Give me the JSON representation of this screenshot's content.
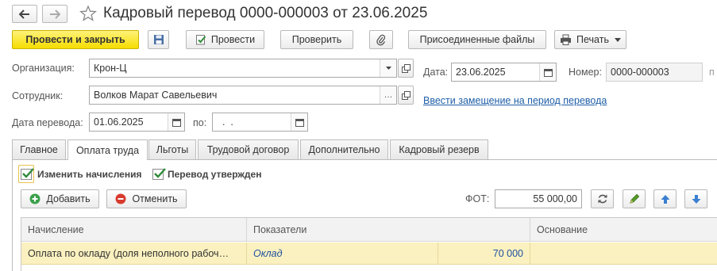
{
  "window": {
    "title": "Кадровый перевод 0000-000003 от 23.06.2025"
  },
  "toolbar": {
    "post_close_label": "Провести и закрыть",
    "post_label": "Провести",
    "check_label": "Проверить",
    "files_label": "Присоединенные файлы",
    "print_label": "Печать"
  },
  "form": {
    "organization_label": "Организация:",
    "organization_value": "Крон-Ц",
    "date_label": "Дата:",
    "date_value": "23.06.2025",
    "number_label": "Номер:",
    "number_value": "0000-000003",
    "number_suffix": "п",
    "employee_label": "Сотрудник:",
    "employee_value": "Волков Марат Савельевич",
    "replacement_link": "Ввести замещение на период перевода",
    "transfer_date_label": "Дата перевода:",
    "transfer_date_value": "01.06.2025",
    "to_label": "по:",
    "to_value": "  .  ."
  },
  "tabs": [
    {
      "label": "Главное"
    },
    {
      "label": "Оплата труда"
    },
    {
      "label": "Льготы"
    },
    {
      "label": "Трудовой договор"
    },
    {
      "label": "Дополнительно"
    },
    {
      "label": "Кадровый резерв"
    }
  ],
  "active_tab": "Оплата труда",
  "payroll": {
    "change_accruals_label": "Изменить начисления",
    "change_accruals_checked": true,
    "approved_label": "Перевод утвержден",
    "approved_checked": true,
    "add_label": "Добавить",
    "cancel_label": "Отменить",
    "fot_label": "ФОТ:",
    "fot_value": "55 000,00"
  },
  "table": {
    "headers": [
      "Начисление",
      "Показатели",
      "Основание"
    ],
    "rows": [
      {
        "accrual": "Оплата по окладу (доля неполного рабоч…",
        "indicator": "Оклад",
        "value": "70 000",
        "basis": ""
      }
    ]
  },
  "colors": {
    "primary_button": "#f5dd00",
    "link": "#1f5fa8",
    "selected_row": "#fbf1c0",
    "check": "#2e8b3a"
  }
}
